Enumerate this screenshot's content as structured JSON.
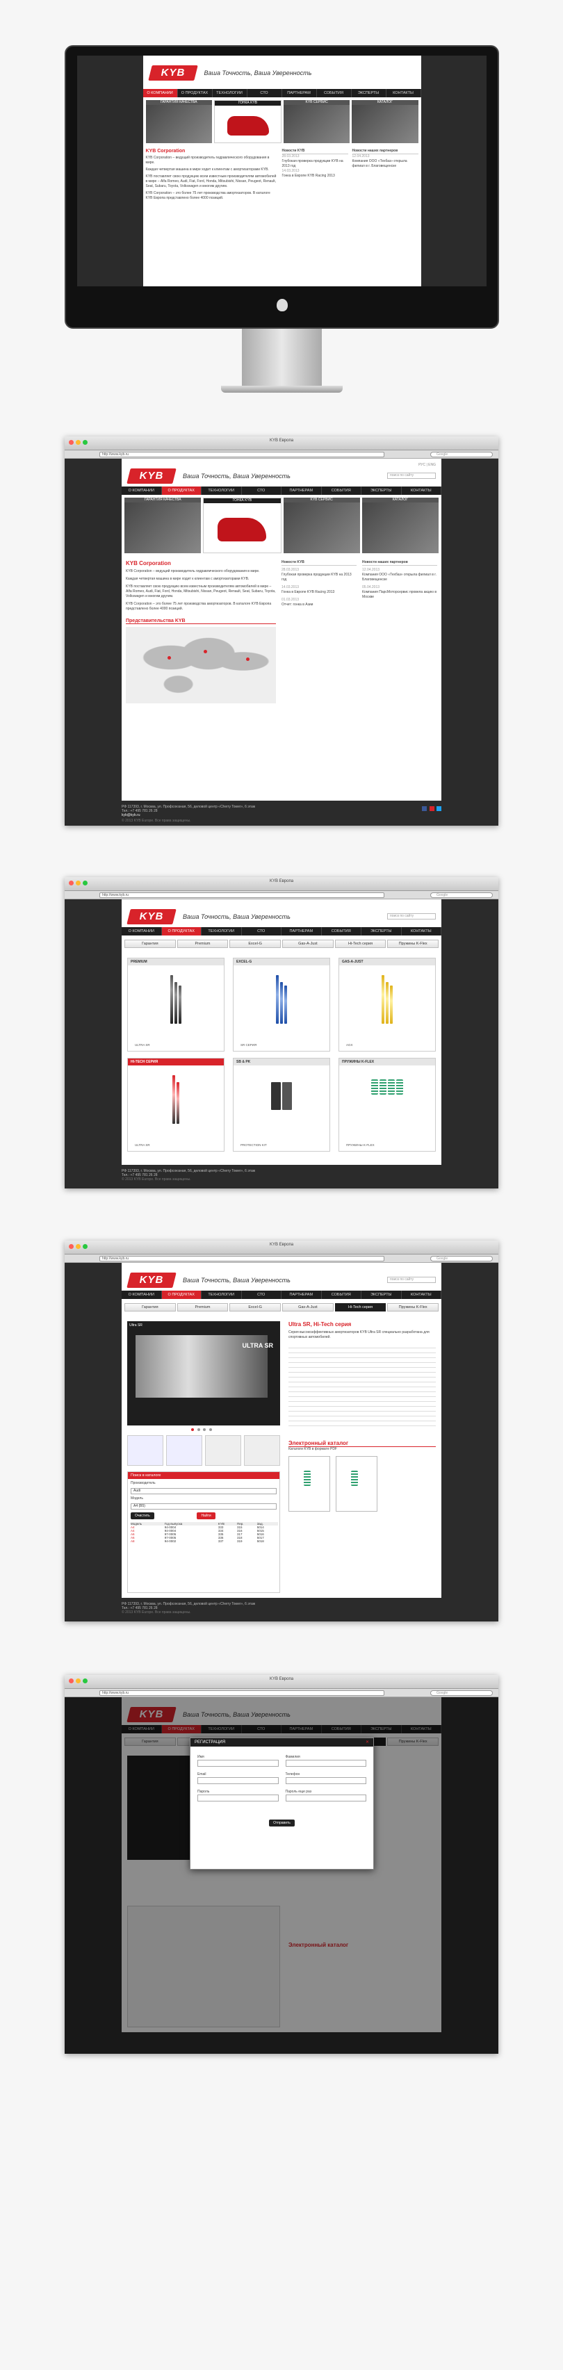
{
  "site": {
    "logo": "KYB",
    "tagline": "Ваша Точность, Ваша Уверенность",
    "window_title": "KYB Европа",
    "url": "http://www.kyb.ru",
    "search_placeholder": "Google",
    "lang": "РУС | ENG",
    "site_search": "поиск по сайту",
    "nav": [
      "О КОМПАНИИ",
      "О ПРОДУКТАХ",
      "ТЕХНОЛОГИИ",
      "СТО",
      "ПАРТНЕРАМ",
      "СОБЫТИЯ",
      "ЭКСПЕРТЫ",
      "КОНТАКТЫ"
    ]
  },
  "home": {
    "sections": [
      "ГАРАНТИЯ КАЧЕСТВА",
      "ГОНКА KYB",
      "KYB СЕРВИС",
      "КАТАЛОГ"
    ],
    "company_title": "KYB Corporation",
    "company_paragraphs": [
      "KYB Corporation – ведущий производитель гидравлического оборудования в мире.",
      "Каждая четвертая машина в мире ходит к клиентам с амортизаторами KYB.",
      "KYB поставляет свою продукцию всем известным производителям автомобилей в мире – Alfa Romeo, Audi, Fiat, Ford, Honda, Mitsubishi, Nissan, Peugeot, Renault, Seat, Subaru, Toyota, Volkswagen и многим другим.",
      "KYB Corporation – это более 75 лет производства амортизаторов. В каталоге KYB Европа представлено более 4000 позиций."
    ],
    "news_title": "Новости KYB",
    "partner_news_title": "Новости наших партнеров",
    "news": [
      {
        "date": "28.03.2013",
        "text": "Глубокая проверка продукции KYB на 2013 год"
      },
      {
        "date": "14.03.2013",
        "text": "Гонка в Европе KYB Racing 2013"
      },
      {
        "date": "01.03.2013",
        "text": "Отчет: гонка в Азии"
      }
    ],
    "partner_news": [
      {
        "date": "12.04.2013",
        "text": "Компания ООО «Техбаз» открыла филиал в г. Благовещенске"
      },
      {
        "date": "05.04.2013",
        "text": "Компания ПарсМоторсервис провела акцию в Москве"
      }
    ],
    "reps_title": "Представительства KYB"
  },
  "footer": {
    "address": "РФ 117393, г. Москва, ул. Профсоюзная, 56, деловой центр «Cherry Tower», 6 этаж",
    "phone": "Тел.: +7 495 781 26 28",
    "email": "kyb@kyb.ru",
    "copyright": "© 2013 KYB Europe. Все права защищены."
  },
  "products": {
    "tabs": [
      "Гарантия",
      "Premium",
      "Excel-G",
      "Gas-A-Just",
      "Hi-Tech серия",
      "Пружины K-Flex"
    ],
    "items": [
      {
        "title": "PREMIUM",
        "caption": "ULTRA SR"
      },
      {
        "title": "EXCEL-G",
        "caption": "SR СЕРИЯ"
      },
      {
        "title": "GAS-A-JUST",
        "caption": "AGX"
      },
      {
        "title": "HI-TECH СЕРИЯ",
        "caption": "ULTRA SR"
      },
      {
        "title": "SB & PK",
        "caption": "PROTECTION KIT"
      },
      {
        "title": "ПРУЖИНЫ K-FLEX",
        "caption": "ПРУЖИНЫ K-FLEX"
      }
    ]
  },
  "detail": {
    "tabs": [
      "Гарантия",
      "Premium",
      "Excel-G",
      "Gas-A-Just",
      "Hi-Tech серия",
      "Пружины K-Flex"
    ],
    "banner_title": "Ultra SR",
    "banner_sub": "ULTRA SR",
    "heading": "Ultra SR, Hi-Tech серия",
    "paragraph": "Серия высокоэффективных амортизаторов KYB Ultra SR специально разработана для спортивных автомобилей.",
    "catalog_title": "Электронный каталог",
    "catalog_sub": "Каталоги KYB в формате PDF",
    "form_title": "Поиск в каталоге",
    "form_labels": [
      "Производитель",
      "Модель"
    ],
    "form_values": [
      "Audi",
      "A4 (B5)"
    ],
    "buttons": [
      "Очистить",
      "Найти"
    ],
    "table_header": [
      "Модель",
      "Год выпуска",
      "KYB",
      "Пер.",
      "Зад.",
      "K-Flex"
    ],
    "table_rows": [
      [
        "A4",
        "94-0004",
        "333",
        "315",
        "5014"
      ],
      [
        "A4",
        "94-0004",
        "334",
        "316",
        "5015"
      ],
      [
        "A6",
        "97-0005",
        "335",
        "317",
        "5016"
      ],
      [
        "A6",
        "97-0005",
        "336",
        "318",
        "5017"
      ],
      [
        "A8",
        "94-0002",
        "337",
        "319",
        "5018"
      ]
    ]
  },
  "modal": {
    "title": "РЕГИСТРАЦИЯ",
    "labels": [
      "Имя",
      "Фамилия",
      "Email",
      "Телефон",
      "Пароль",
      "Пароль еще раз"
    ],
    "submit": "Отправить"
  }
}
